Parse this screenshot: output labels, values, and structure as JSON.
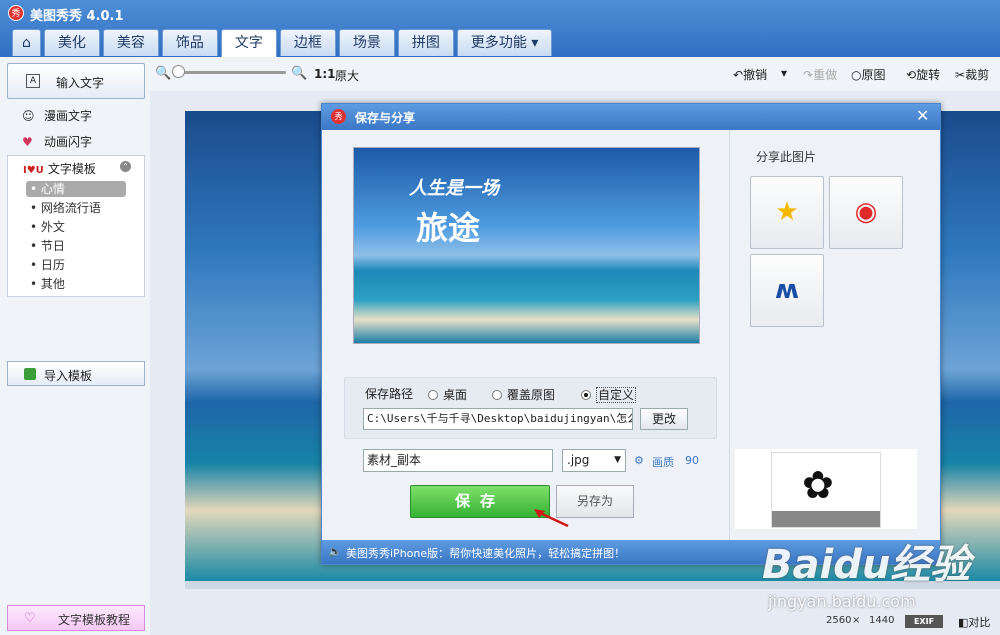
{
  "app": {
    "title": "美图秀秀 4.0.1",
    "icon": "meitu-logo-icon"
  },
  "tabs": [
    "美化",
    "美容",
    "饰品",
    "文字",
    "边框",
    "场景",
    "拼图",
    "更多功能"
  ],
  "active_tab": "文字",
  "toolbar": {
    "ratio": "1:1",
    "original_size": "原大",
    "undo": "撤销",
    "redo": "重做",
    "original": "原图",
    "rotate": "旋转",
    "crop": "裁剪"
  },
  "sidebar": {
    "input_text": "输入文字",
    "comic_text": "漫画文字",
    "animated_text": "动画闪字",
    "templates_title": "文字模板",
    "template_items": [
      "心情",
      "网络流行语",
      "外文",
      "节日",
      "日历",
      "其他"
    ],
    "selected_template": "心情",
    "import_templates": "导入模板",
    "tutorial": "文字模板教程"
  },
  "dialog": {
    "title": "保存与分享",
    "preview_title_line1": "人生是一场",
    "preview_title_line2": "旅途",
    "save_path_label": "保存路径",
    "options": [
      "桌面",
      "覆盖原图",
      "自定义"
    ],
    "selected_option": "自定义",
    "path_value": "C:\\Users\\千与千寻\\Desktop\\baidujingyan\\怎么",
    "change_button": "更改",
    "filename": "素材_副本",
    "extension": ".jpg",
    "quality_label": "画质",
    "quality_value": "90",
    "save_button": "保存",
    "save_as_button": "另存为",
    "share_label": "分享此图片",
    "tip": "美图秀秀iPhone版：帮你快速美化照片，轻松搞定拼图！"
  },
  "status": {
    "width": "2560",
    "times": "×",
    "height": "1440",
    "exif": "EXIF",
    "compare": "对比"
  },
  "watermark": {
    "brand": "Baidu经验",
    "url": "jingyan.baidu.com"
  }
}
